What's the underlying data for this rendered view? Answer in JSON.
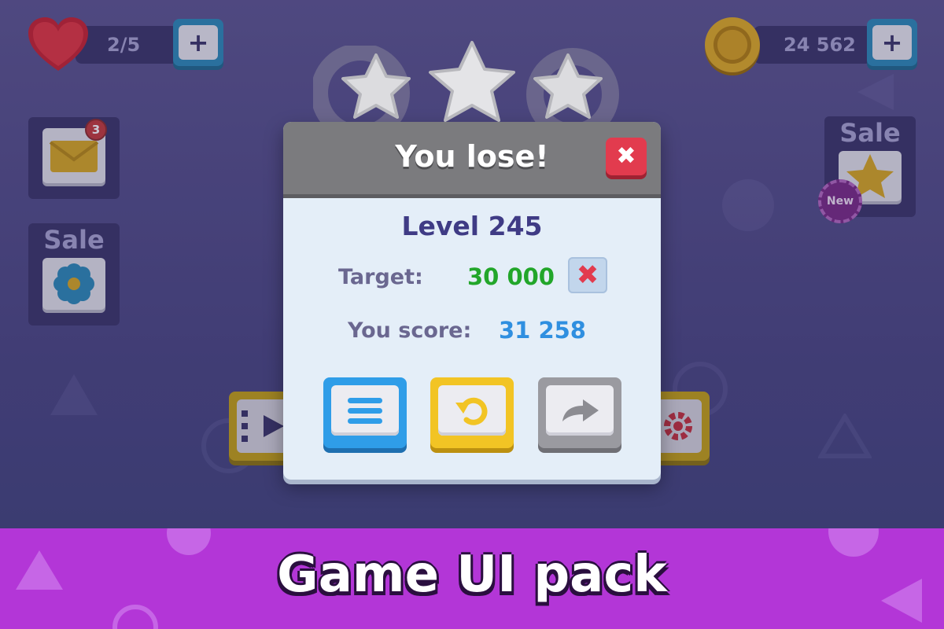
{
  "hud": {
    "lives": "2/5",
    "coins": "24 562",
    "plus_symbol": "+",
    "heart_icon": "heart-icon",
    "coin_icon": "coin-icon"
  },
  "left_panel": {
    "mail_badge_count": "3",
    "sale_label": "Sale",
    "mail_icon": "envelope-icon",
    "flower_icon": "flower-icon"
  },
  "right_panel": {
    "sale_label": "Sale",
    "new_badge": "New",
    "star_icon": "star-icon"
  },
  "popup": {
    "title": "You lose!",
    "close_symbol": "✖",
    "stars_earned": 0,
    "stars_total": 3,
    "level": "Level 245",
    "target_label": "Target:",
    "target_value": "30 000",
    "target_status_symbol": "✖",
    "score_label": "You score:",
    "score_value": "31 258"
  },
  "buttons": {
    "menu_icon": "menu-icon",
    "retry_icon": "retry-icon",
    "next_icon": "arrow-right-icon"
  },
  "colors": {
    "menu_button": "#2f9de8",
    "retry_button": "#f2c424",
    "next_button": "#9a9aa0",
    "close_button": "#e23b4e",
    "target_value": "#22a62a",
    "score_value": "#2f8fe0",
    "footer": "#b336d7"
  },
  "footer": {
    "title": "Game UI pack"
  }
}
